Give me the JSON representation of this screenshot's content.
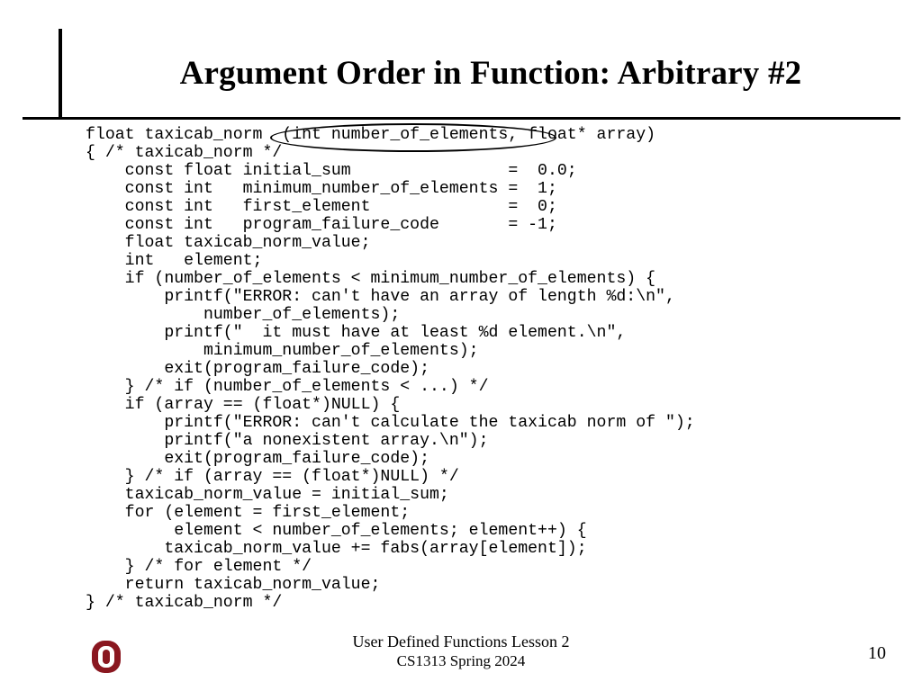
{
  "title": "Argument Order in Function: Arbitrary #2",
  "code": "float taxicab_norm  (int number_of_elements, float* array)\n{ /* taxicab_norm */\n    const float initial_sum                =  0.0;\n    const int   minimum_number_of_elements =  1;\n    const int   first_element              =  0;\n    const int   program_failure_code       = -1;\n    float taxicab_norm_value;\n    int   element;\n    if (number_of_elements < minimum_number_of_elements) {\n        printf(\"ERROR: can't have an array of length %d:\\n\",\n            number_of_elements);\n        printf(\"  it must have at least %d element.\\n\",\n            minimum_number_of_elements);\n        exit(program_failure_code);\n    } /* if (number_of_elements < ...) */\n    if (array == (float*)NULL) {\n        printf(\"ERROR: can't calculate the taxicab norm of \");\n        printf(\"a nonexistent array.\\n\");\n        exit(program_failure_code);\n    } /* if (array == (float*)NULL) */\n    taxicab_norm_value = initial_sum;\n    for (element = first_element;\n         element < number_of_elements; element++) {\n        taxicab_norm_value += fabs(array[element]);\n    } /* for element */\n    return taxicab_norm_value;\n} /* taxicab_norm */",
  "footer": {
    "line1": "User Defined Functions Lesson 2",
    "line2": "CS1313 Spring 2024"
  },
  "page_number": "10"
}
